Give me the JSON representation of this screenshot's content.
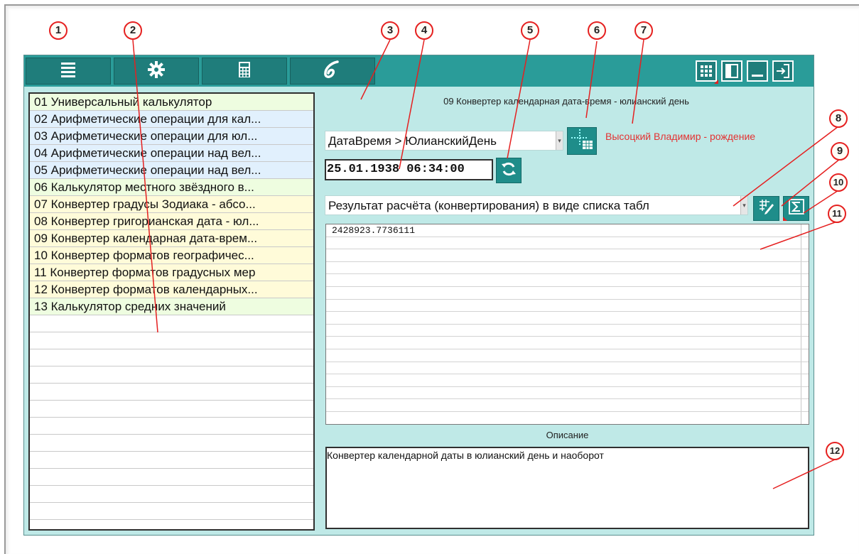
{
  "toolbar": {
    "buttons": [
      {
        "icon": "list-icon"
      },
      {
        "icon": "gear-icon"
      },
      {
        "icon": "calculator-icon"
      },
      {
        "icon": "logo-icon"
      }
    ],
    "right_buttons": [
      {
        "icon": "grid-view-icon"
      },
      {
        "icon": "panel-icon"
      },
      {
        "icon": "minimize-icon"
      },
      {
        "icon": "exit-icon"
      }
    ]
  },
  "calculators": [
    {
      "label": "01 Универсальный калькулятор",
      "color": "#eefde0"
    },
    {
      "label": "02 Арифметические операции для кал...",
      "color": "#e1f0fd"
    },
    {
      "label": "03 Арифметические операции для юл...",
      "color": "#e1f0fd"
    },
    {
      "label": "04 Арифметические операции над вел...",
      "color": "#e1f0fd"
    },
    {
      "label": "05 Арифметические операции над вел...",
      "color": "#e1f0fd"
    },
    {
      "label": "06 Калькулятор местного звёздного в...",
      "color": "#eefde0"
    },
    {
      "label": "07 Конвертер градусы Зодиака - абсо...",
      "color": "#fffbd9"
    },
    {
      "label": "08 Конвертер григорианская дата - юл...",
      "color": "#fffbd9"
    },
    {
      "label": "09 Конвертер календарная дата-врем...",
      "color": "#fffbd9"
    },
    {
      "label": "10 Конвертер форматов географичес...",
      "color": "#fffbd9"
    },
    {
      "label": "11 Конвертер форматов градусных мер",
      "color": "#fffbd9"
    },
    {
      "label": "12 Конвертер форматов календарных...",
      "color": "#fffbd9"
    },
    {
      "label": "13 Калькулятор средних значений",
      "color": "#eefde0"
    }
  ],
  "panel": {
    "title": "09 Конвертер календарная дата-время - юлианский день",
    "mode_value": "ДатаВремя > ЮлианскийДень",
    "person_label": "Высоцкий Владимир - рождение",
    "datetime_value": "25.01.1938 06:34:00",
    "result_mode_value": "Результат расчёта (конвертирования) в виде списка табл",
    "result_rows": [
      "2428923.7736111"
    ],
    "description_label": "Описание",
    "description_text": "Конвертер календарной даты в юлианский день и наоборот"
  },
  "callouts": [
    "1",
    "2",
    "3",
    "4",
    "5",
    "6",
    "7",
    "8",
    "9",
    "10",
    "11",
    "12"
  ],
  "colors": {
    "accent": "#2a9c99",
    "callout_red": "#e52020",
    "panel_bg": "#bfe9e7"
  }
}
